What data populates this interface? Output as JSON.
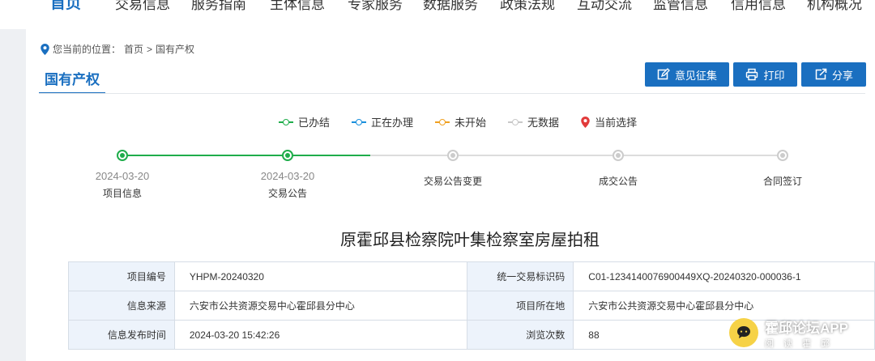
{
  "nav": {
    "items": [
      "首页",
      "交易信息",
      "服务指南",
      "主体信息",
      "专家服务",
      "数据服务",
      "政策法规",
      "互动交流",
      "监管信息",
      "信用信息",
      "机构概况"
    ]
  },
  "breadcrumb": {
    "prefix": "您当前的位置：",
    "home": "首页",
    "sep": ">",
    "current": "国有产权"
  },
  "section_tab": "国有产权",
  "actions": {
    "feedback": "意见征集",
    "print": "打印",
    "share": "分享"
  },
  "legend": [
    {
      "label": "已办结",
      "color": "#1fad4b"
    },
    {
      "label": "正在办理",
      "color": "#1a8fdc"
    },
    {
      "label": "未开始",
      "color": "#f0a020"
    },
    {
      "label": "无数据",
      "color": "#c8c8c8"
    },
    {
      "label": "当前选择",
      "color": "#e23b3b"
    }
  ],
  "timeline": [
    {
      "date": "2024-03-20",
      "label": "项目信息",
      "status": "done"
    },
    {
      "date": "2024-03-20",
      "label": "交易公告",
      "status": "done"
    },
    {
      "date": "",
      "label": "交易公告变更",
      "status": "nodata"
    },
    {
      "date": "",
      "label": "成交公告",
      "status": "nodata"
    },
    {
      "date": "",
      "label": "合同签订",
      "status": "nodata"
    }
  ],
  "title": "原霍邱县检察院叶集检察室房屋拍租",
  "info": {
    "project_no_label": "项目编号",
    "project_no": "YHPM-20240320",
    "trade_id_label": "统一交易标识码",
    "trade_id": "C01-1234140076900449XQ-20240320-000036-1",
    "source_label": "信息来源",
    "source": "六安市公共资源交易中心霍邱县分中心",
    "location_label": "项目所在地",
    "location": "六安市公共资源交易中心霍邱县分中心",
    "publish_time_label": "信息发布时间",
    "publish_time": "2024-03-20 15:42:26",
    "views_label": "浏览次数",
    "views": "88"
  },
  "app_badge": {
    "name": "霍邱论坛APP",
    "slogan": "阅读霍邱"
  }
}
